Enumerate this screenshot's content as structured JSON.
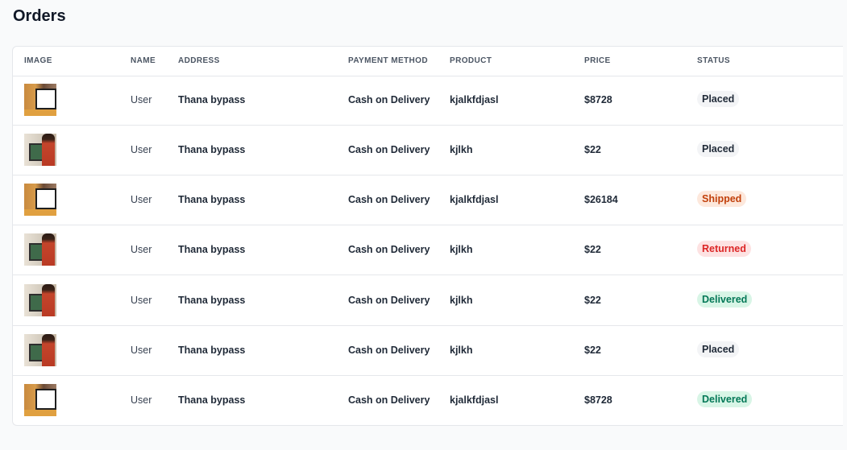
{
  "page": {
    "title": "Orders"
  },
  "table": {
    "headers": {
      "image": "IMAGE",
      "name": "NAME",
      "address": "ADDRESS",
      "payment_method": "PAYMENT METHOD",
      "product": "PRODUCT",
      "price": "PRICE",
      "status": "STATUS"
    },
    "rows": [
      {
        "thumbnail": "product-thumbnail-frame",
        "name": "User",
        "address": "Thana bypass",
        "payment_method": "Cash on Delivery",
        "product": "kjalkfdjasl",
        "price": "$8728",
        "status": "Placed",
        "status_kind": "placed"
      },
      {
        "thumbnail": "product-thumbnail-painting",
        "name": "User",
        "address": "Thana bypass",
        "payment_method": "Cash on Delivery",
        "product": "kjlkh",
        "price": "$22",
        "status": "Placed",
        "status_kind": "placed"
      },
      {
        "thumbnail": "product-thumbnail-frame",
        "name": "User",
        "address": "Thana bypass",
        "payment_method": "Cash on Delivery",
        "product": "kjalkfdjasl",
        "price": "$26184",
        "status": "Shipped",
        "status_kind": "shipped"
      },
      {
        "thumbnail": "product-thumbnail-painting",
        "name": "User",
        "address": "Thana bypass",
        "payment_method": "Cash on Delivery",
        "product": "kjlkh",
        "price": "$22",
        "status": "Returned",
        "status_kind": "returned"
      },
      {
        "thumbnail": "product-thumbnail-painting",
        "name": "User",
        "address": "Thana bypass",
        "payment_method": "Cash on Delivery",
        "product": "kjlkh",
        "price": "$22",
        "status": "Delivered",
        "status_kind": "delivered"
      },
      {
        "thumbnail": "product-thumbnail-painting",
        "name": "User",
        "address": "Thana bypass",
        "payment_method": "Cash on Delivery",
        "product": "kjlkh",
        "price": "$22",
        "status": "Placed",
        "status_kind": "placed"
      },
      {
        "thumbnail": "product-thumbnail-frame",
        "name": "User",
        "address": "Thana bypass",
        "payment_method": "Cash on Delivery",
        "product": "kjalkfdjasl",
        "price": "$8728",
        "status": "Delivered",
        "status_kind": "delivered"
      }
    ]
  },
  "status_colors": {
    "placed": {
      "bg": "#f3f4f6",
      "fg": "#1f2937"
    },
    "shipped": {
      "bg": "#fde8dc",
      "fg": "#c2410c"
    },
    "returned": {
      "bg": "#fde2e2",
      "fg": "#dc2626"
    },
    "delivered": {
      "bg": "#d8f5e6",
      "fg": "#047857"
    }
  }
}
